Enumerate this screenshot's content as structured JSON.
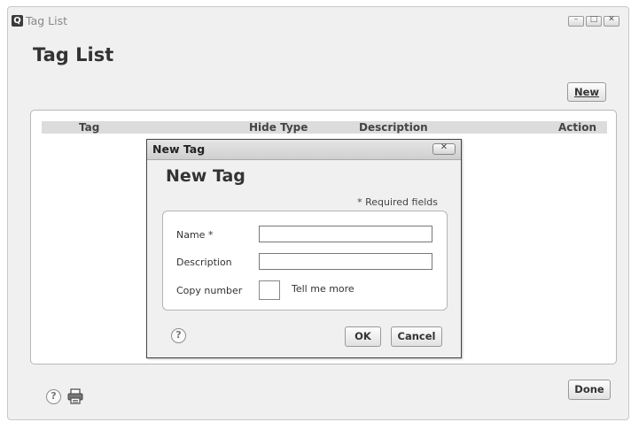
{
  "window": {
    "app_icon_letter": "Q",
    "title": "Tag List",
    "controls": {
      "minimize": "–",
      "maximize": "□",
      "close": "✕"
    }
  },
  "page": {
    "title": "Tag List"
  },
  "toolbar": {
    "new_label": "New"
  },
  "table": {
    "columns": [
      "Tag",
      "Hide Type",
      "Description",
      "Action"
    ]
  },
  "dialog": {
    "titlebar": "New Tag",
    "close_glyph": "✕",
    "heading": "New Tag",
    "required_note": "* Required fields",
    "fields": {
      "name_label": "Name *",
      "name_value": "",
      "description_label": "Description",
      "description_value": "",
      "copy_number_label": "Copy number",
      "tell_more_label": "Tell me more"
    },
    "help_glyph": "?",
    "ok_label": "OK",
    "cancel_label": "Cancel"
  },
  "footer": {
    "help_glyph": "?",
    "done_label": "Done"
  },
  "icons": [
    "app-icon",
    "minimize-icon",
    "maximize-icon",
    "close-icon",
    "help-icon",
    "print-icon"
  ]
}
